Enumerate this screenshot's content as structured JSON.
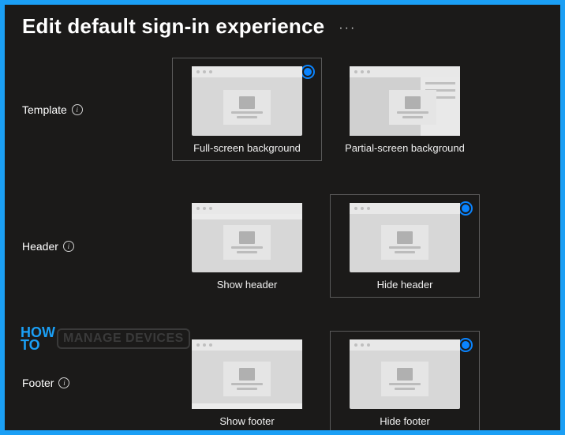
{
  "title": "Edit default sign-in experience",
  "rows": {
    "template": {
      "label": "Template",
      "options": [
        {
          "label": "Full-screen background",
          "selected": true
        },
        {
          "label": "Partial-screen background",
          "selected": false
        }
      ]
    },
    "header": {
      "label": "Header",
      "options": [
        {
          "label": "Show header",
          "selected": false
        },
        {
          "label": "Hide header",
          "selected": true
        }
      ]
    },
    "footer": {
      "label": "Footer",
      "options": [
        {
          "label": "Show footer",
          "selected": false
        },
        {
          "label": "Hide footer",
          "selected": true
        }
      ]
    }
  },
  "watermark": {
    "line1": "HOW",
    "line2": "TO",
    "box": "MANAGE DEVICES"
  }
}
